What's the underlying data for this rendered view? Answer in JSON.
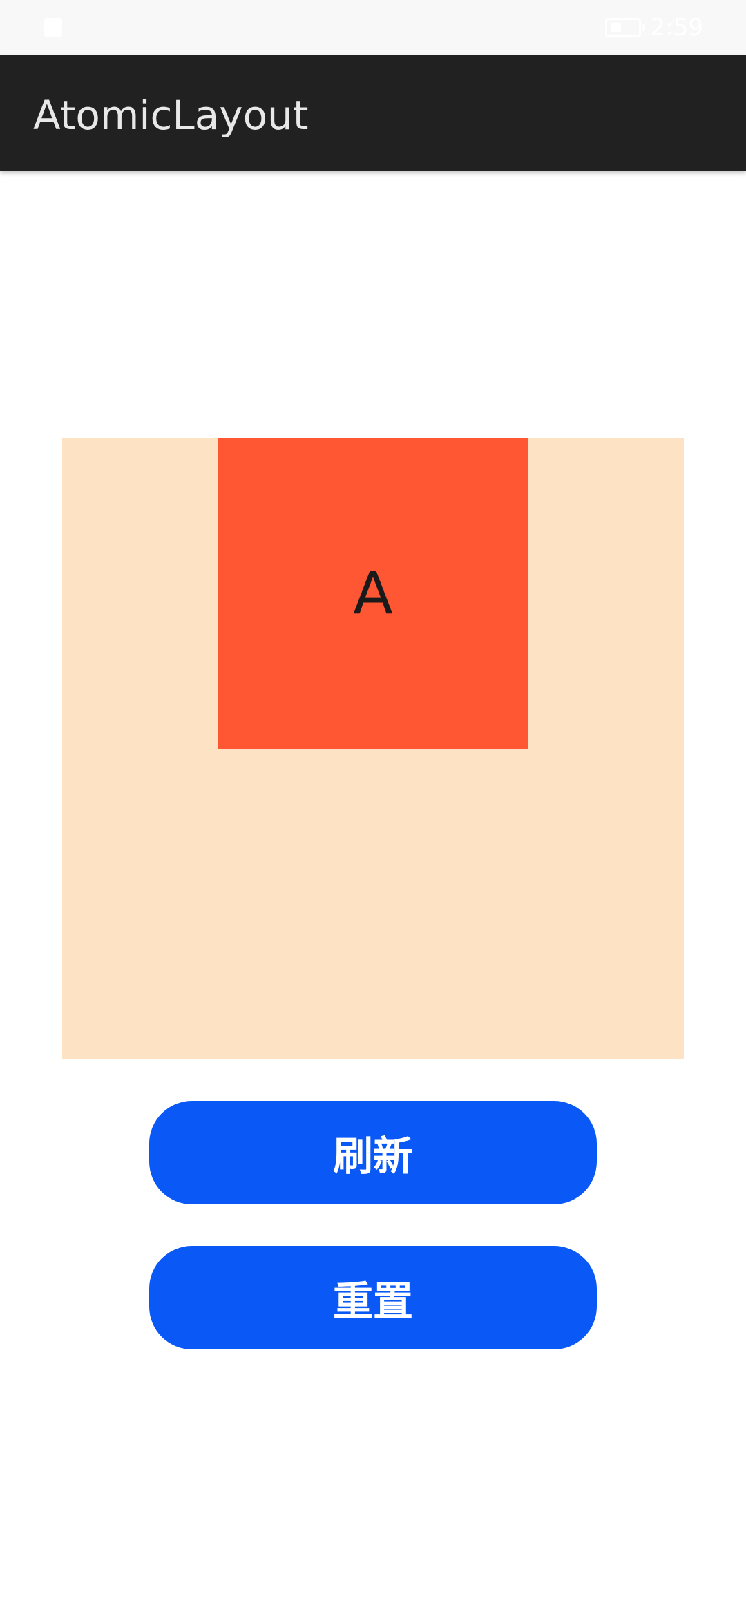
{
  "status_bar": {
    "time": "2:59",
    "battery_icon": "battery-icon",
    "left_icon": "notification-icon"
  },
  "app_bar": {
    "title": "AtomicLayout",
    "background_color": "#212121"
  },
  "layout": {
    "container_color": "#fde3c3",
    "box_a": {
      "label": "A",
      "color": "#ff5733"
    }
  },
  "buttons": {
    "refresh_label": "刷新",
    "reset_label": "重置",
    "color": "#0a59f7"
  }
}
